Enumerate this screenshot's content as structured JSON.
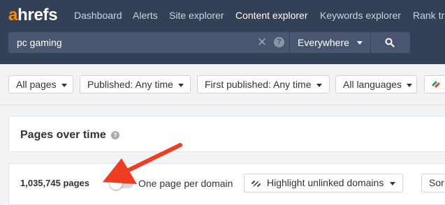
{
  "brand": {
    "logo_a": "a",
    "logo_rest": "hrefs",
    "accent": "#ff8800"
  },
  "nav": {
    "items": [
      {
        "label": "Dashboard"
      },
      {
        "label": "Alerts"
      },
      {
        "label": "Site explorer"
      },
      {
        "label": "Content explorer",
        "active": true
      },
      {
        "label": "Keywords explorer"
      },
      {
        "label": "Rank tr"
      }
    ]
  },
  "search": {
    "value": "pc gaming",
    "clear_icon": "close-icon",
    "help_icon": "help-icon",
    "help_glyph": "?"
  },
  "scope": {
    "selected": "Everywhere"
  },
  "search_button": {
    "icon": "search-icon"
  },
  "filters": {
    "all_pages": "All pages",
    "published": "Published: Any time",
    "first_published": "First published: Any time",
    "languages": "All languages",
    "extra_icon": "link-icon"
  },
  "chart_panel": {
    "title": "Pages over time",
    "help_glyph": "?"
  },
  "results": {
    "count": "1,035,745 pages",
    "toggle_label": "One page per domain",
    "toggle_on": false,
    "highlight_label": "Highlight unlinked domains",
    "sort_label": "Sor"
  },
  "annotation": {
    "arrow_color": "#f03d22"
  }
}
